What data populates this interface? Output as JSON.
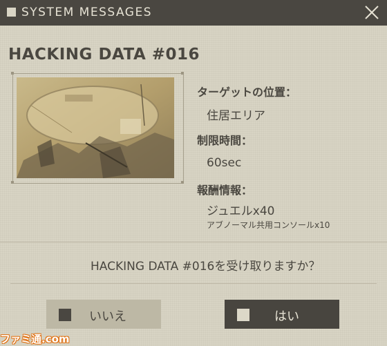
{
  "window": {
    "title": "SYSTEM MESSAGES"
  },
  "heading": "HACKING DATA #016",
  "details": {
    "target_label": "ターゲットの位置：",
    "target_value": "住居エリア",
    "time_label": "制限時間：",
    "time_value": "60sec",
    "reward_label": "報酬情報：",
    "reward_value_1": "ジュエルx40",
    "reward_value_2": "アブノーマル共用コンソールx10"
  },
  "question": "HACKING DATA #016を受け取りますか？",
  "buttons": {
    "no_label": "いいえ",
    "yes_label": "はい"
  },
  "watermark": "ファミ通.com",
  "colors": {
    "titlebar": "#4a4741",
    "background": "#d8d4c4",
    "accent_dark": "#48453f"
  }
}
